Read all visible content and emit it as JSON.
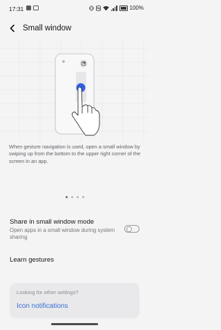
{
  "status_bar": {
    "time": "17:31",
    "battery": "100%"
  },
  "header": {
    "title": "Small window"
  },
  "illustration": {
    "icons": [
      "phone-frame-icon",
      "small-window-icon",
      "swipe-gesture-hand-icon"
    ]
  },
  "description": "When gesture navigation is used, open a small window by swiping up from the bottom to the upper right corner of the screen in an app.",
  "pager": {
    "pages": 4,
    "active": 1
  },
  "settings": {
    "share": {
      "title": "Share in small window mode",
      "subtitle": "Open apps in a small window during system sharing",
      "enabled": false
    },
    "gestures": {
      "title": "Learn gestures"
    }
  },
  "other_settings": {
    "hint": "Looking for other settings?",
    "link": "Icon notifications"
  },
  "colors": {
    "background": "#f4f4f5",
    "accent": "#3b6fd8",
    "illustration_blue": "#2f5fe3"
  }
}
